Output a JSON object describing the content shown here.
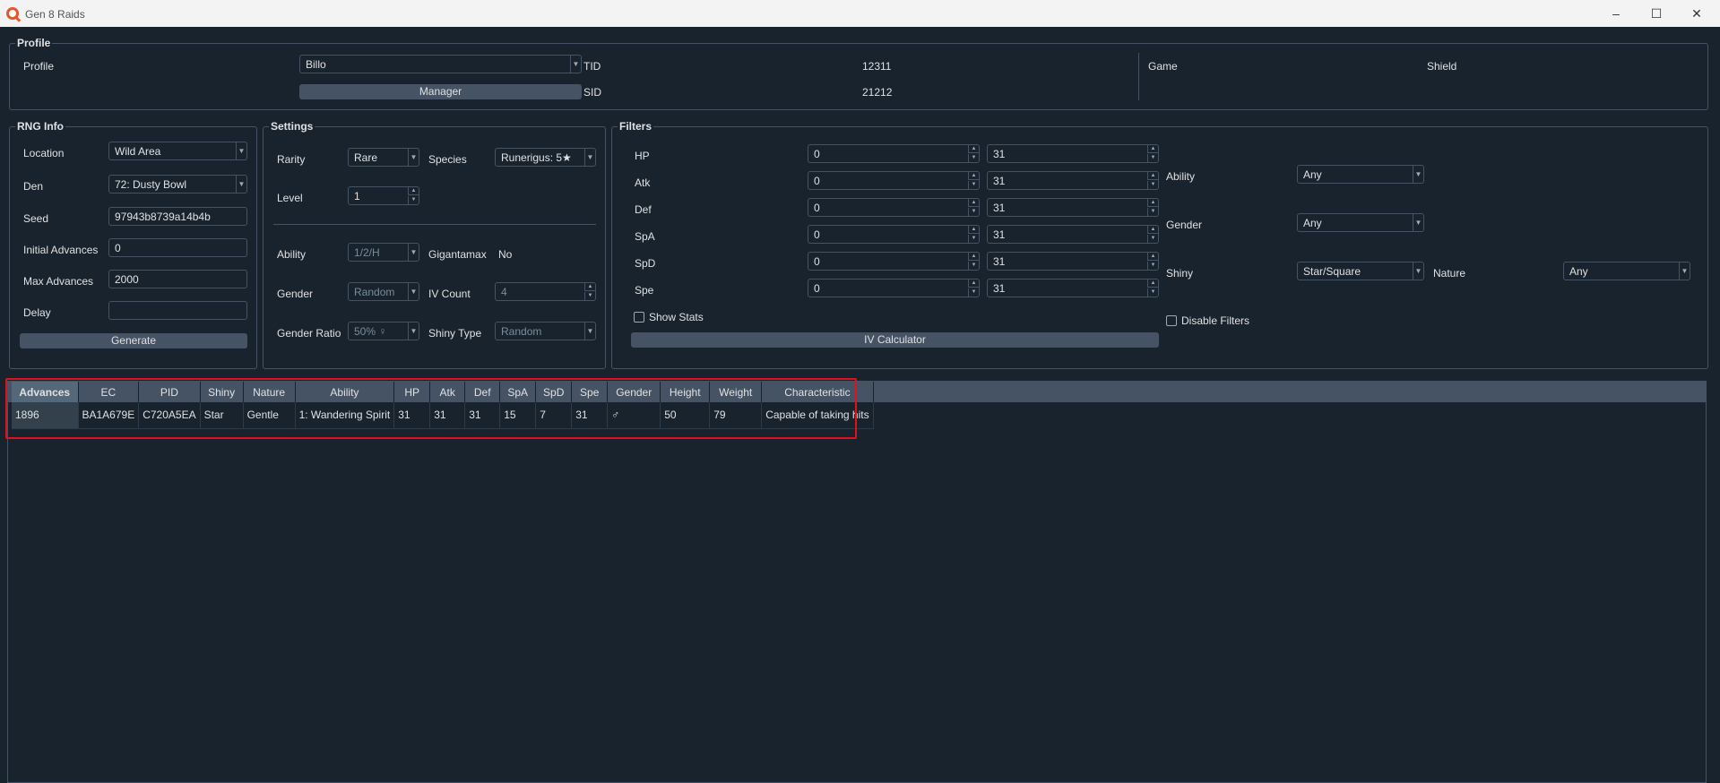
{
  "window": {
    "title": "Gen 8 Raids"
  },
  "profile": {
    "group_title": "Profile",
    "profile_label": "Profile",
    "profile_value": "Billo",
    "manager_button": "Manager",
    "tid_label": "TID",
    "tid_value": "12311",
    "sid_label": "SID",
    "sid_value": "21212",
    "game_label": "Game",
    "game_value": "Shield"
  },
  "rng": {
    "group_title": "RNG Info",
    "location_label": "Location",
    "location_value": "Wild Area",
    "den_label": "Den",
    "den_value": "72: Dusty Bowl",
    "seed_label": "Seed",
    "seed_value": "97943b8739a14b4b",
    "initial_label": "Initial Advances",
    "initial_value": "0",
    "max_label": "Max Advances",
    "max_value": "2000",
    "delay_label": "Delay",
    "delay_value": "",
    "generate_button": "Generate"
  },
  "settings": {
    "group_title": "Settings",
    "rarity_label": "Rarity",
    "rarity_value": "Rare",
    "species_label": "Species",
    "species_value": "Runerigus: 5★",
    "level_label": "Level",
    "level_value": "1",
    "ability_label": "Ability",
    "ability_value": "1/2/H",
    "gigantamax_label": "Gigantamax",
    "gigantamax_value": "No",
    "gender_label": "Gender",
    "gender_value": "Random",
    "ivcount_label": "IV Count",
    "ivcount_value": "4",
    "ratio_label": "Gender Ratio",
    "ratio_value": "50% ♀",
    "shinytype_label": "Shiny Type",
    "shinytype_value": "Random"
  },
  "filters": {
    "group_title": "Filters",
    "stats": [
      {
        "label": "HP",
        "min": "0",
        "max": "31"
      },
      {
        "label": "Atk",
        "min": "0",
        "max": "31"
      },
      {
        "label": "Def",
        "min": "0",
        "max": "31"
      },
      {
        "label": "SpA",
        "min": "0",
        "max": "31"
      },
      {
        "label": "SpD",
        "min": "0",
        "max": "31"
      },
      {
        "label": "Spe",
        "min": "0",
        "max": "31"
      }
    ],
    "show_stats_label": "Show Stats",
    "iv_calculator_button": "IV Calculator",
    "ability_label": "Ability",
    "ability_value": "Any",
    "gender_label": "Gender",
    "gender_value": "Any",
    "shiny_label": "Shiny",
    "shiny_value": "Star/Square",
    "nature_label": "Nature",
    "nature_value": "Any",
    "disable_filters_label": "Disable Filters"
  },
  "results": {
    "columns": [
      "Advances",
      "EC",
      "PID",
      "Shiny",
      "Nature",
      "Ability",
      "HP",
      "Atk",
      "Def",
      "SpA",
      "SpD",
      "Spe",
      "Gender",
      "Height",
      "Weight",
      "Characteristic"
    ],
    "rows": [
      [
        "1896",
        "BA1A679E",
        "C720A5EA",
        "Star",
        "Gentle",
        "1: Wandering Spirit",
        "31",
        "31",
        "31",
        "15",
        "7",
        "31",
        "♂",
        "50",
        "79",
        "Capable of taking hits"
      ]
    ]
  },
  "colors": {
    "background": "#19232d",
    "border": "#455364",
    "highlight": "#e0111c"
  }
}
